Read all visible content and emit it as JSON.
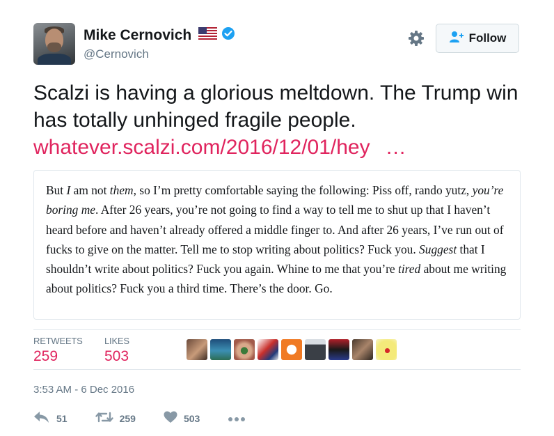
{
  "user": {
    "display_name": "Mike Cernovich",
    "handle": "@Cernovich",
    "verified": true
  },
  "follow_button": {
    "label": "Follow"
  },
  "tweet": {
    "text": "Scalzi is having a glorious meltdown. The Trump win has totally unhinged fragile people.",
    "link_text": "whatever.scalzi.com/2016/12/01/hey",
    "link_ellipsis": "…"
  },
  "quote": {
    "s1": "But ",
    "e1": "I",
    "s2": " am not ",
    "e2": "them",
    "s3": ", so I’m pretty comfortable saying the following: Piss off, rando yutz, ",
    "e3": "you’re boring me",
    "s4": ". After 26 years, you’re not going to find a way to tell me to shut up that I haven’t heard before and haven’t already offered a middle finger to. And after 26 years, I’ve run out of fucks to give on the matter. Tell me to stop writing about politics? Fuck you. ",
    "e4": "Suggest",
    "s5": " that I shouldn’t write about politics? Fuck you again. Whine to me that you’re ",
    "e5": "tired",
    "s6": " about me writing about politics? Fuck you a third time. There’s the door. Go."
  },
  "stats": {
    "retweets_label": "RETWEETS",
    "retweets_value": "259",
    "likes_label": "LIKES",
    "likes_value": "503"
  },
  "timestamp": "3:53 AM - 6 Dec 2016",
  "actions": {
    "reply_count": "51",
    "retweet_count": "259",
    "like_count": "503"
  },
  "colors": {
    "accent": "#e0245e",
    "muted": "#657786",
    "text": "#14171a",
    "border": "#e1e8ed",
    "verified": "#1da1f2"
  },
  "icons": [
    "us-flag-icon",
    "verified-badge-icon",
    "gear-icon",
    "follow-person-icon",
    "reply-icon",
    "retweet-icon",
    "heart-icon",
    "more-icon"
  ]
}
